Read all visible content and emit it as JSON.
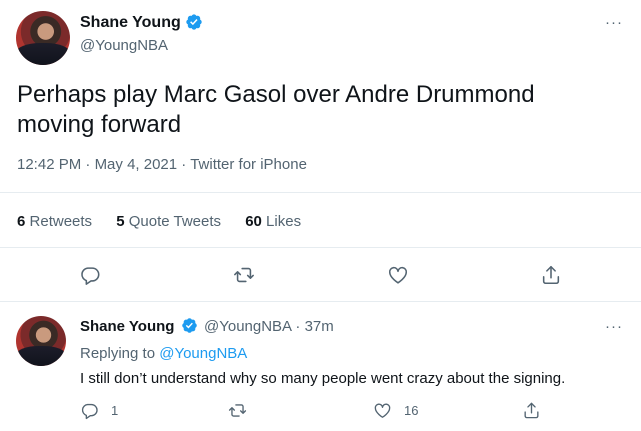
{
  "main_tweet": {
    "author_name": "Shane Young",
    "author_handle": "@YoungNBA",
    "text": "Perhaps play Marc Gasol over Andre Drummond moving forward",
    "time": "12:42 PM",
    "date": "May 4, 2021",
    "source": "Twitter for iPhone",
    "separator": "·",
    "stats": {
      "retweets_count": "6",
      "retweets_label": "Retweets",
      "quote_count": "5",
      "quote_label": "Quote Tweets",
      "likes_count": "60",
      "likes_label": "Likes"
    },
    "actions": [
      "reply-icon",
      "retweet-icon",
      "like-icon",
      "share-icon"
    ]
  },
  "reply_tweet": {
    "author_name": "Shane Young",
    "author_handle": "@YoungNBA",
    "separator": "·",
    "age": "37m",
    "replying_prefix": "Replying to",
    "replying_to": "@YoungNBA",
    "text": "I still don’t understand why so many people went crazy about the signing.",
    "reply_count": "1",
    "like_count": "16"
  },
  "more_glyph": "···",
  "colors": {
    "accent": "#1d9bf0",
    "text_primary": "#0f1419",
    "text_secondary": "#536471",
    "divider": "#e6ecf0"
  }
}
